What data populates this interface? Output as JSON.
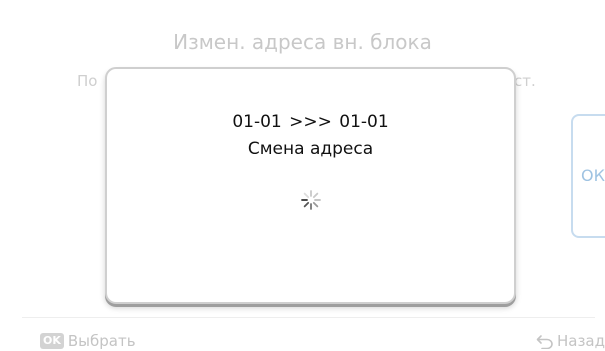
{
  "background": {
    "title": "Измен. адреса вн. блока",
    "subtitle_left": "По",
    "subtitle_right": "ст.",
    "ok_button_label": "ОК"
  },
  "modal": {
    "from_address": "01-01",
    "arrow": ">>>",
    "to_address": "01-01",
    "status": "Смена адреса",
    "spinner_icon": "loading-spinner-icon"
  },
  "footer": {
    "ok_badge": "OK",
    "select_label": "Выбрать",
    "back_icon": "back-arrow-icon",
    "back_label": "Назад"
  }
}
